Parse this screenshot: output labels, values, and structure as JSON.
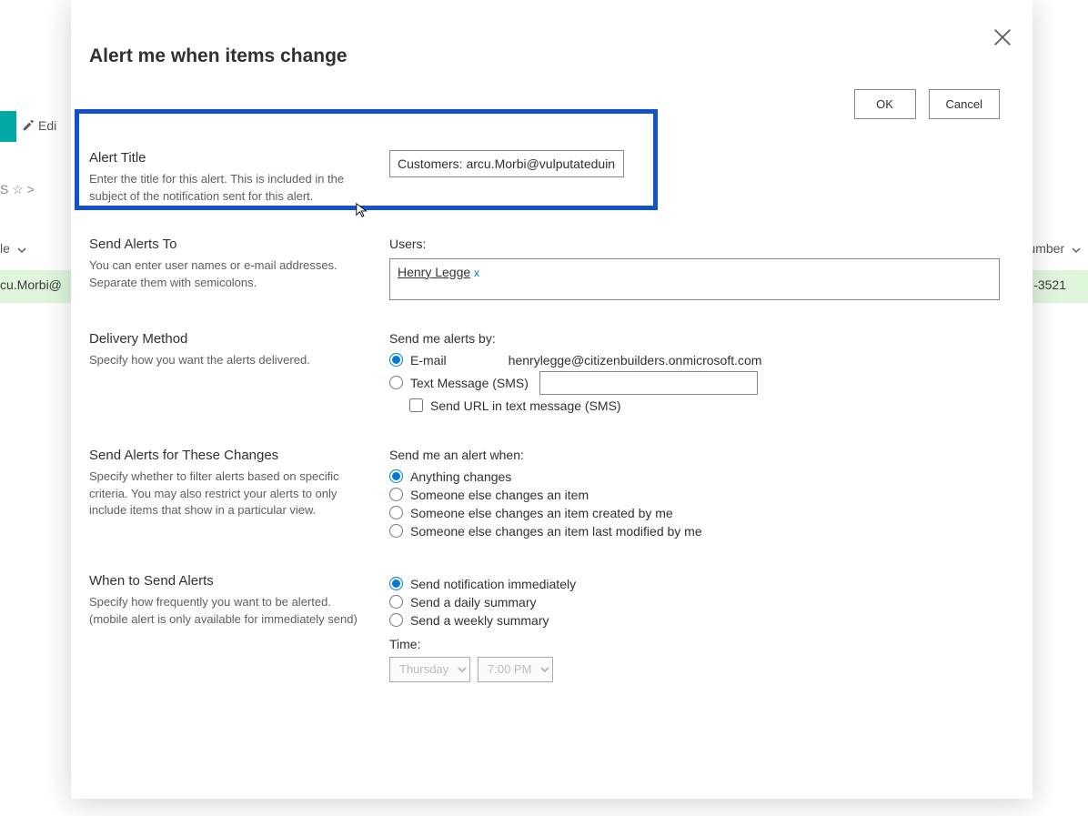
{
  "bg": {
    "edit": "Edi",
    "star_row": "S  ☆  >",
    "col_left": "le",
    "col_right": "umber",
    "row_left": "cu.Morbi@",
    "row_right": "-3521"
  },
  "modal": {
    "title": "Alert me when items change",
    "buttons": {
      "ok": "OK",
      "cancel": "Cancel"
    },
    "alert_title": {
      "label": "Alert Title",
      "desc": "Enter the title for this alert. This is included in the subject of the notification sent for this alert.",
      "value": "Customers: arcu.Morbi@vulputateduinec."
    },
    "send_to": {
      "label": "Send Alerts To",
      "desc": "You can enter user names or e-mail addresses. Separate them with semicolons.",
      "field_label": "Users:",
      "user": "Henry Legge",
      "remove": "x"
    },
    "delivery": {
      "label": "Delivery Method",
      "desc": "Specify how you want the alerts delivered.",
      "field_label": "Send me alerts by:",
      "email_opt": "E-mail",
      "email_addr": "henrylegge@citizenbuilders.onmicrosoft.com",
      "sms_opt": "Text Message (SMS)",
      "sms_check": "Send URL in text message (SMS)"
    },
    "changes": {
      "label": "Send Alerts for These Changes",
      "desc": "Specify whether to filter alerts based on specific criteria. You may also restrict your alerts to only include items that show in a particular view.",
      "field_label": "Send me an alert when:",
      "opt1": "Anything changes",
      "opt2": "Someone else changes an item",
      "opt3": "Someone else changes an item created by me",
      "opt4": "Someone else changes an item last modified by me"
    },
    "when": {
      "label": "When to Send Alerts",
      "desc": "Specify how frequently you want to be alerted. (mobile alert is only available for immediately send)",
      "opt1": "Send notification immediately",
      "opt2": "Send a daily summary",
      "opt3": "Send a weekly summary",
      "time_label": "Time:",
      "day": "Thursday",
      "hour": "7:00 PM"
    }
  }
}
